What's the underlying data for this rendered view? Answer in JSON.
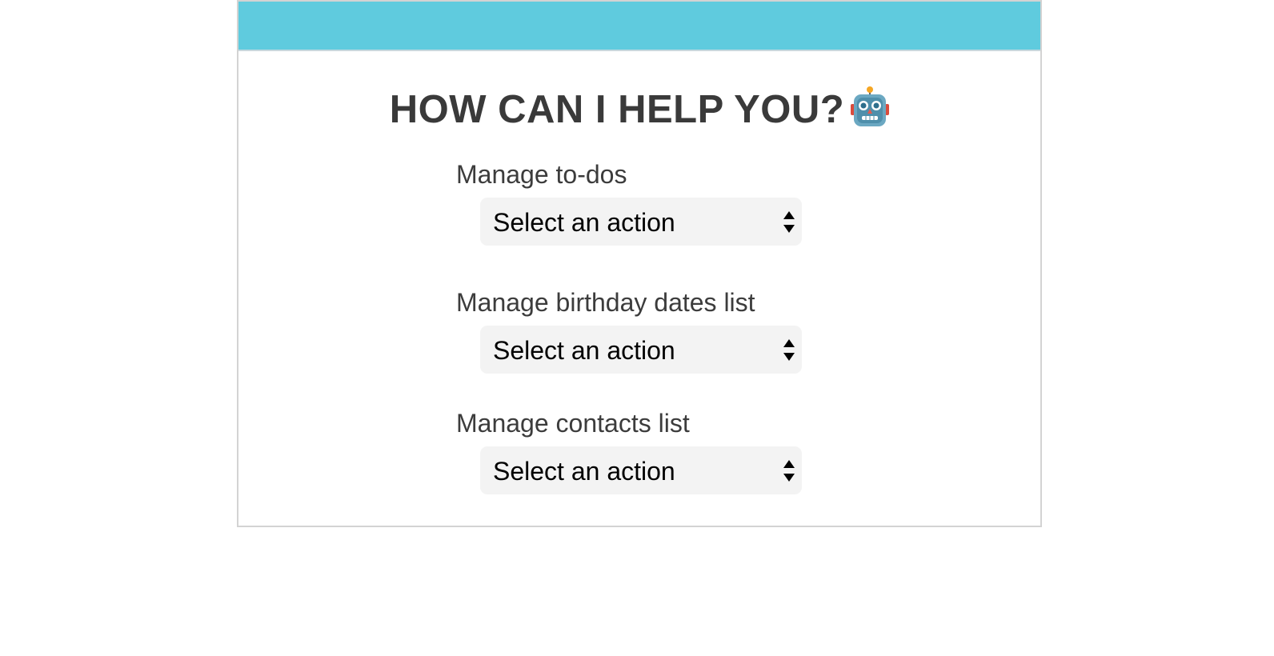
{
  "colors": {
    "header_bar": "#5fcbde",
    "text": "#3a3a3a",
    "select_bg": "#f3f3f3"
  },
  "heading": {
    "title": "HOW CAN I HELP YOU?",
    "icon": "robot-icon"
  },
  "groups": [
    {
      "label": "Manage to-dos",
      "select_value": "Select an action"
    },
    {
      "label": "Manage birthday dates list",
      "select_value": "Select an action"
    },
    {
      "label": "Manage contacts list",
      "select_value": "Select an action"
    }
  ]
}
